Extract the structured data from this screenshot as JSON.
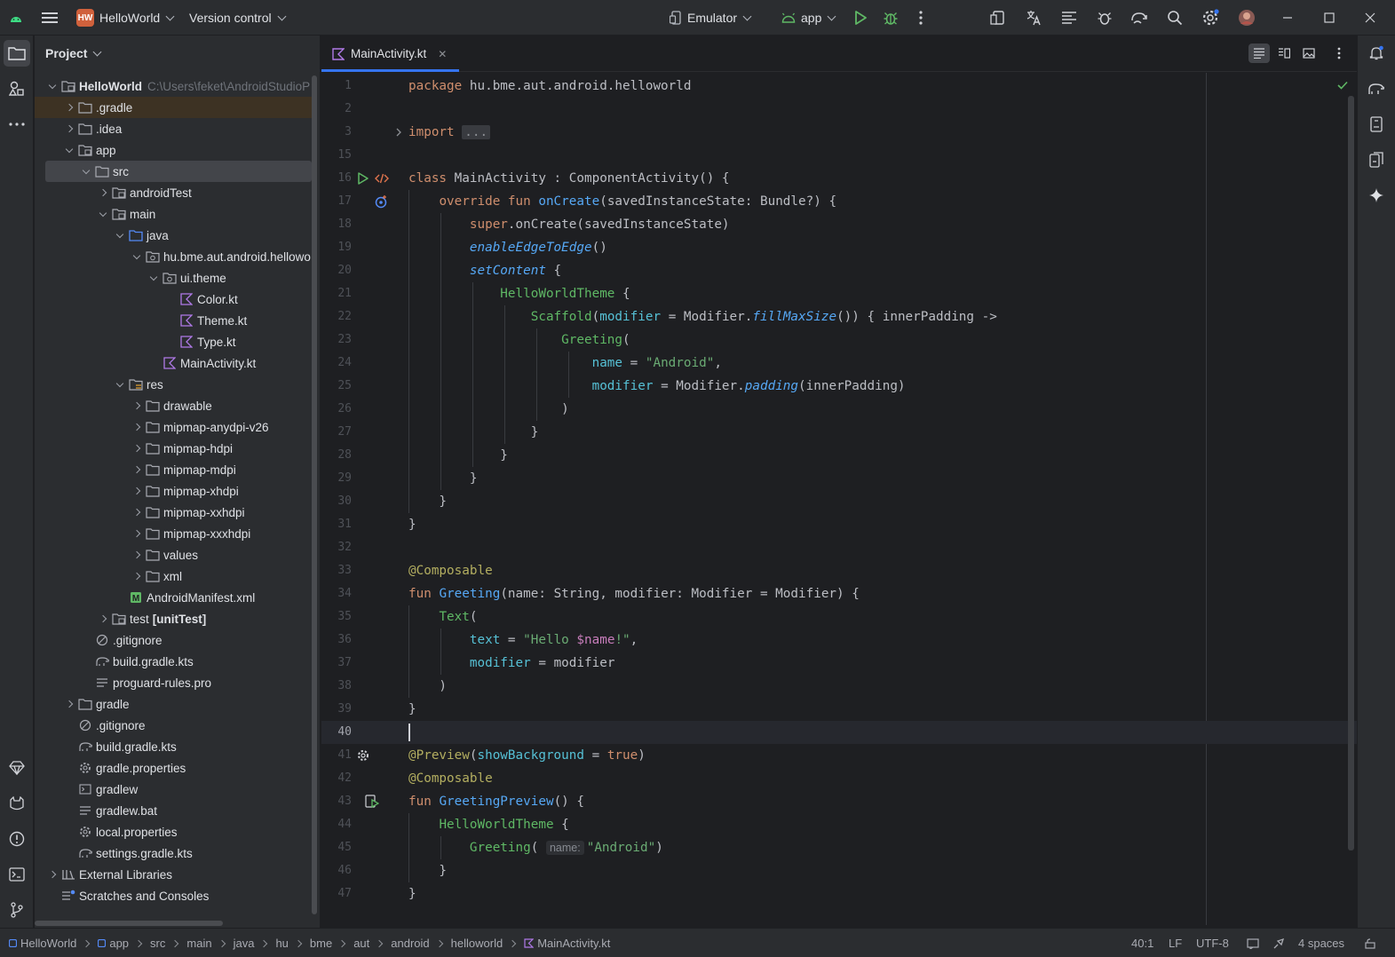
{
  "titlebar": {
    "project_badge": "HW",
    "project_name": "HelloWorld",
    "vcs_label": "Version control",
    "device_label": "Emulator",
    "run_config": "app"
  },
  "project_panel": {
    "title": "Project",
    "tree": [
      {
        "label": "HelloWorld",
        "path": "C:\\Users\\feket\\AndroidStudioP",
        "depth": 0,
        "expand": "open",
        "icon": "module-icon",
        "bold": true
      },
      {
        "label": ".gradle",
        "depth": 1,
        "expand": "closed",
        "icon": "folder-icon",
        "highlight": true
      },
      {
        "label": ".idea",
        "depth": 1,
        "expand": "closed",
        "icon": "folder-icon"
      },
      {
        "label": "app",
        "depth": 1,
        "expand": "open",
        "icon": "module-folder-icon"
      },
      {
        "label": "src",
        "depth": 2,
        "expand": "open",
        "icon": "folder-icon",
        "selected": true
      },
      {
        "label": "androidTest",
        "depth": 3,
        "expand": "closed",
        "icon": "source-folder-icon"
      },
      {
        "label": "main",
        "depth": 3,
        "expand": "open",
        "icon": "source-folder-icon"
      },
      {
        "label": "java",
        "depth": 4,
        "expand": "open",
        "icon": "java-folder-icon"
      },
      {
        "label": "hu.bme.aut.android.hellowo",
        "depth": 5,
        "expand": "open",
        "icon": "package-icon"
      },
      {
        "label": "ui.theme",
        "depth": 6,
        "expand": "open",
        "icon": "package-icon"
      },
      {
        "label": "Color.kt",
        "depth": 7,
        "expand": "none",
        "icon": "kotlin-file-icon"
      },
      {
        "label": "Theme.kt",
        "depth": 7,
        "expand": "none",
        "icon": "kotlin-file-icon"
      },
      {
        "label": "Type.kt",
        "depth": 7,
        "expand": "none",
        "icon": "kotlin-file-icon"
      },
      {
        "label": "MainActivity.kt",
        "depth": 6,
        "expand": "none",
        "icon": "kotlin-file-icon"
      },
      {
        "label": "res",
        "depth": 4,
        "expand": "open",
        "icon": "res-folder-icon"
      },
      {
        "label": "drawable",
        "depth": 5,
        "expand": "closed",
        "icon": "folder-icon"
      },
      {
        "label": "mipmap-anydpi-v26",
        "depth": 5,
        "expand": "closed",
        "icon": "folder-icon"
      },
      {
        "label": "mipmap-hdpi",
        "depth": 5,
        "expand": "closed",
        "icon": "folder-icon"
      },
      {
        "label": "mipmap-mdpi",
        "depth": 5,
        "expand": "closed",
        "icon": "folder-icon"
      },
      {
        "label": "mipmap-xhdpi",
        "depth": 5,
        "expand": "closed",
        "icon": "folder-icon"
      },
      {
        "label": "mipmap-xxhdpi",
        "depth": 5,
        "expand": "closed",
        "icon": "folder-icon"
      },
      {
        "label": "mipmap-xxxhdpi",
        "depth": 5,
        "expand": "closed",
        "icon": "folder-icon"
      },
      {
        "label": "values",
        "depth": 5,
        "expand": "closed",
        "icon": "folder-icon"
      },
      {
        "label": "xml",
        "depth": 5,
        "expand": "closed",
        "icon": "folder-icon"
      },
      {
        "label": "AndroidManifest.xml",
        "depth": 4,
        "expand": "none",
        "icon": "manifest-file-icon"
      },
      {
        "label": "test",
        "suffix": "[unitTest]",
        "depth": 3,
        "expand": "closed",
        "icon": "source-folder-icon"
      },
      {
        "label": ".gitignore",
        "depth": 2,
        "expand": "none",
        "icon": "ignore-file-icon"
      },
      {
        "label": "build.gradle.kts",
        "depth": 2,
        "expand": "none",
        "icon": "gradle-file-icon"
      },
      {
        "label": "proguard-rules.pro",
        "depth": 2,
        "expand": "none",
        "icon": "text-file-icon"
      },
      {
        "label": "gradle",
        "depth": 1,
        "expand": "closed",
        "icon": "folder-icon"
      },
      {
        "label": ".gitignore",
        "depth": 1,
        "expand": "none",
        "icon": "ignore-file-icon"
      },
      {
        "label": "build.gradle.kts",
        "depth": 1,
        "expand": "none",
        "icon": "gradle-file-icon"
      },
      {
        "label": "gradle.properties",
        "depth": 1,
        "expand": "none",
        "icon": "settings-file-icon"
      },
      {
        "label": "gradlew",
        "depth": 1,
        "expand": "none",
        "icon": "terminal-file-icon"
      },
      {
        "label": "gradlew.bat",
        "depth": 1,
        "expand": "none",
        "icon": "text-file-icon"
      },
      {
        "label": "local.properties",
        "depth": 1,
        "expand": "none",
        "icon": "settings-file-icon"
      },
      {
        "label": "settings.gradle.kts",
        "depth": 1,
        "expand": "none",
        "icon": "gradle-file-icon"
      },
      {
        "label": "External Libraries",
        "depth": 0,
        "expand": "closed",
        "icon": "library-icon"
      },
      {
        "label": "Scratches and Consoles",
        "depth": 0,
        "expand": "none",
        "icon": "scratches-icon"
      }
    ]
  },
  "editor": {
    "tab_label": "MainActivity.kt",
    "lines": [
      {
        "n": "1",
        "html": "<span class=\"k\">package</span> hu.bme.aut.android.helloworld"
      },
      {
        "n": "2",
        "html": ""
      },
      {
        "n": "3",
        "html": "<span class=\"k\">import</span> <span class=\"fold\">...</span>"
      },
      {
        "n": "15",
        "html": ""
      },
      {
        "n": "16",
        "html": "<span class=\"k\">class</span> MainActivity : ComponentActivity() {"
      },
      {
        "n": "17",
        "html": "    <span class=\"k\">override fun</span> <span class=\"fn\">onCreate</span>(savedInstanceState: Bundle?) {"
      },
      {
        "n": "18",
        "html": "        <span class=\"k\">super</span>.onCreate(savedInstanceState)"
      },
      {
        "n": "19",
        "html": "        <span class=\"it\">enableEdgeToEdge</span>()"
      },
      {
        "n": "20",
        "html": "        <span class=\"it\">setContent</span> {"
      },
      {
        "n": "21",
        "html": "            <span class=\"comp\">HelloWorldTheme</span> {"
      },
      {
        "n": "22",
        "html": "                <span class=\"comp\">Scaffold</span>(<span class=\"prm\">modifier</span> = Modifier.<span class=\"it\">fillMaxSize</span>()) { innerPadding -&gt;"
      },
      {
        "n": "23",
        "html": "                    <span class=\"comp\">Greeting</span>("
      },
      {
        "n": "24",
        "html": "                        <span class=\"prm\">name</span> = <span class=\"str\">\"Android\"</span>,"
      },
      {
        "n": "25",
        "html": "                        <span class=\"prm\">modifier</span> = Modifier.<span class=\"it\">padding</span>(innerPadding)"
      },
      {
        "n": "26",
        "html": "                    )"
      },
      {
        "n": "27",
        "html": "                }"
      },
      {
        "n": "28",
        "html": "            }"
      },
      {
        "n": "29",
        "html": "        }"
      },
      {
        "n": "30",
        "html": "    }"
      },
      {
        "n": "31",
        "html": "}"
      },
      {
        "n": "32",
        "html": ""
      },
      {
        "n": "33",
        "html": "<span class=\"ann\">@Composable</span>"
      },
      {
        "n": "34",
        "html": "<span class=\"k\">fun</span> <span class=\"fn\">Greeting</span>(name: String, modifier: Modifier = Modifier) {"
      },
      {
        "n": "35",
        "html": "    <span class=\"comp\">Text</span>("
      },
      {
        "n": "36",
        "html": "        <span class=\"prm\">text</span> = <span class=\"str\">\"Hello </span><span class=\"nm\">$name</span><span class=\"str\">!\"</span>,"
      },
      {
        "n": "37",
        "html": "        <span class=\"prm\">modifier</span> = modifier"
      },
      {
        "n": "38",
        "html": "    )"
      },
      {
        "n": "39",
        "html": "}"
      },
      {
        "n": "40",
        "html": "",
        "current": true
      },
      {
        "n": "41",
        "html": "<span class=\"ann\">@Preview</span>(<span class=\"prm\">showBackground</span> = <span class=\"k\">true</span>)"
      },
      {
        "n": "42",
        "html": "<span class=\"ann\">@Composable</span>"
      },
      {
        "n": "43",
        "html": "<span class=\"k\">fun</span> <span class=\"fn\">GreetingPreview</span>() {"
      },
      {
        "n": "44",
        "html": "    <span class=\"comp\">HelloWorldTheme</span> {"
      },
      {
        "n": "45",
        "html": "        <span class=\"comp\">Greeting</span>( <span class=\"hint\">name:</span><span class=\"str\">\"Android\"</span>)"
      },
      {
        "n": "46",
        "html": "    }"
      },
      {
        "n": "47",
        "html": "}"
      }
    ]
  },
  "statusbar": {
    "breadcrumbs": [
      "HelloWorld",
      "app",
      "src",
      "main",
      "java",
      "hu",
      "bme",
      "aut",
      "android",
      "helloworld",
      "MainActivity.kt"
    ],
    "position": "40:1",
    "line_separator": "LF",
    "encoding": "UTF-8",
    "indent": "4 spaces"
  },
  "colors": {
    "accent": "#3574f0",
    "background": "#1e1f22",
    "panel": "#2b2d30",
    "run_green": "#5fb865"
  }
}
